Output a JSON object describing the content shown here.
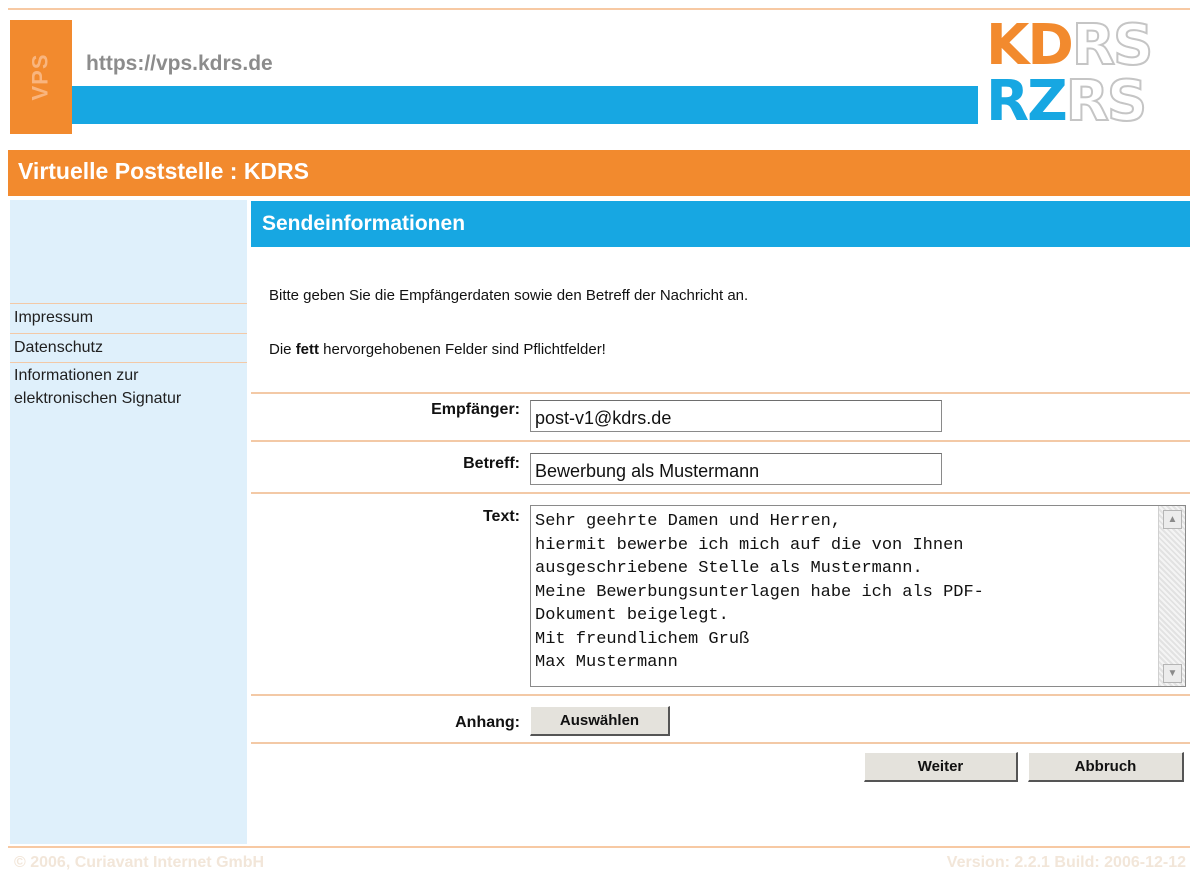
{
  "header": {
    "vps_label": "VPS",
    "url": "https://vps.kdrs.de",
    "logo": {
      "line1_a": "KD",
      "line1_b": "RS",
      "line2_a": "RZ",
      "line2_b": "RS"
    }
  },
  "title_bar": {
    "title": "Virtuelle Poststelle : KDRS"
  },
  "sidebar": {
    "items": [
      {
        "label": "Impressum"
      },
      {
        "label": "Datenschutz"
      },
      {
        "label": "Informationen zur"
      },
      {
        "label": "elektronischen Signatur"
      }
    ]
  },
  "main": {
    "section_title": "Sendeinformationen",
    "intro": "Bitte geben Sie die Empfängerdaten sowie den Betreff der Nachricht an.",
    "required_prefix": "Die ",
    "required_bold": "fett",
    "required_suffix": " hervorgehobenen Felder sind Pflichtfelder!",
    "form": {
      "recipient_label": "Empfänger:",
      "recipient_value": "post-v1@kdrs.de",
      "subject_label": "Betreff:",
      "subject_value": "Bewerbung als Mustermann",
      "text_label": "Text:",
      "text_value": "Sehr geehrte Damen und Herren,\nhiermit bewerbe ich mich auf die von Ihnen\nausgeschriebene Stelle als Mustermann.\nMeine Bewerbungsunterlagen habe ich als PDF-\nDokument beigelegt.\nMit freundlichem Gruß\nMax Mustermann",
      "attachment_label": "Anhang:",
      "choose_button": "Auswählen",
      "next_button": "Weiter",
      "cancel_button": "Abbruch"
    }
  },
  "footer": {
    "copyright": "© 2006, Curiavant Internet GmbH",
    "version": "Version: 2.2.1  Build: 2006-12-12"
  }
}
